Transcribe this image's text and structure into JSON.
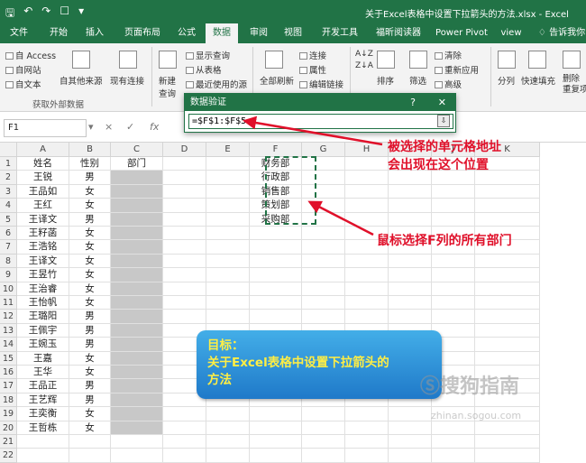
{
  "window": {
    "title": "关于Excel表格中设置下拉箭头的方法.xlsx - Excel",
    "quick_access": [
      "save-icon",
      "undo-icon",
      "redo-icon",
      "touch-icon",
      "customize-icon"
    ]
  },
  "menu": {
    "tabs": [
      "文件",
      "开始",
      "插入",
      "页面布局",
      "公式",
      "数据",
      "审阅",
      "视图",
      "开发工具",
      "福昕阅读器",
      "Power Pivot",
      "view"
    ],
    "tell_me": "告诉我你",
    "active_tab": "数据"
  },
  "ribbon": {
    "from_access": "自 Access",
    "from_web": "自网站",
    "from_text": "自文本",
    "from_other": "自其他来源",
    "existing_conn": "现有连接",
    "new_query": "新建",
    "new_query2": "查询",
    "show_query": "显示查询",
    "from_table": "从表格",
    "recent_sources": "最近使用的源",
    "refresh_all": "全部刷新",
    "connections": "连接",
    "properties": "属性",
    "edit_links": "编辑链接",
    "sort": "排序",
    "filter": "筛选",
    "clear": "清除",
    "reapply": "重新应用",
    "advanced": "高级",
    "split": "分列",
    "flash_fill": "快速填充",
    "remove_dup": "删除",
    "remove_dup2": "重复项",
    "group_label": "获取外部数据"
  },
  "formula_bar": {
    "name_box": "F1",
    "cancel": "×",
    "enter": "✓",
    "fx": "fx"
  },
  "columns": [
    "A",
    "B",
    "C",
    "D",
    "E",
    "F",
    "G",
    "H",
    "I",
    "J",
    "K"
  ],
  "rows": [
    {
      "n": "1",
      "a": "姓名",
      "b": "性别",
      "c": "部门",
      "f": "财务部"
    },
    {
      "n": "2",
      "a": "王锐",
      "b": "男",
      "c": "",
      "f": "行政部"
    },
    {
      "n": "3",
      "a": "王品如",
      "b": "女",
      "c": "",
      "f": "销售部"
    },
    {
      "n": "4",
      "a": "王红",
      "b": "女",
      "c": "",
      "f": "策划部"
    },
    {
      "n": "5",
      "a": "王译文",
      "b": "男",
      "c": "",
      "f": "采购部"
    },
    {
      "n": "6",
      "a": "王籽菡",
      "b": "女",
      "c": "",
      "f": ""
    },
    {
      "n": "7",
      "a": "王浩铭",
      "b": "女",
      "c": "",
      "f": ""
    },
    {
      "n": "8",
      "a": "王译文",
      "b": "女",
      "c": "",
      "f": ""
    },
    {
      "n": "9",
      "a": "王昱竹",
      "b": "女",
      "c": "",
      "f": ""
    },
    {
      "n": "10",
      "a": "王治睿",
      "b": "女",
      "c": "",
      "f": ""
    },
    {
      "n": "11",
      "a": "王怡帆",
      "b": "女",
      "c": "",
      "f": ""
    },
    {
      "n": "12",
      "a": "王璐阳",
      "b": "男",
      "c": "",
      "f": ""
    },
    {
      "n": "13",
      "a": "王佩宇",
      "b": "男",
      "c": "",
      "f": ""
    },
    {
      "n": "14",
      "a": "王婉玉",
      "b": "男",
      "c": "",
      "f": ""
    },
    {
      "n": "15",
      "a": "王嘉",
      "b": "女",
      "c": "",
      "f": ""
    },
    {
      "n": "16",
      "a": "王华",
      "b": "女",
      "c": "",
      "f": ""
    },
    {
      "n": "17",
      "a": "王品正",
      "b": "男",
      "c": "",
      "f": ""
    },
    {
      "n": "18",
      "a": "王艺辉",
      "b": "男",
      "c": "",
      "f": ""
    },
    {
      "n": "19",
      "a": "王奕衡",
      "b": "女",
      "c": "",
      "f": ""
    },
    {
      "n": "20",
      "a": "王哲栋",
      "b": "女",
      "c": "",
      "f": ""
    },
    {
      "n": "21",
      "a": "",
      "b": "",
      "c": "",
      "f": ""
    },
    {
      "n": "22",
      "a": "",
      "b": "",
      "c": "",
      "f": ""
    }
  ],
  "dialog": {
    "title": "数据验证",
    "help": "?",
    "close": "✕",
    "value": "=$F$1:$F$5"
  },
  "annotations": {
    "top_line1": "被选择的单元格地址",
    "top_line2": "会出现在这个位置",
    "mid": "鼠标选择F列的所有部门",
    "accent": "#e0102a"
  },
  "callout": {
    "line1": "目标：",
    "line2": "关于Excel表格中设置下拉箭头的",
    "line3": "方法"
  },
  "watermark": {
    "text": "搜狗指南",
    "url": "zhinan.sogou.com"
  },
  "colors": {
    "excel_green": "#217346",
    "selection_gray": "#c8c8c8"
  }
}
